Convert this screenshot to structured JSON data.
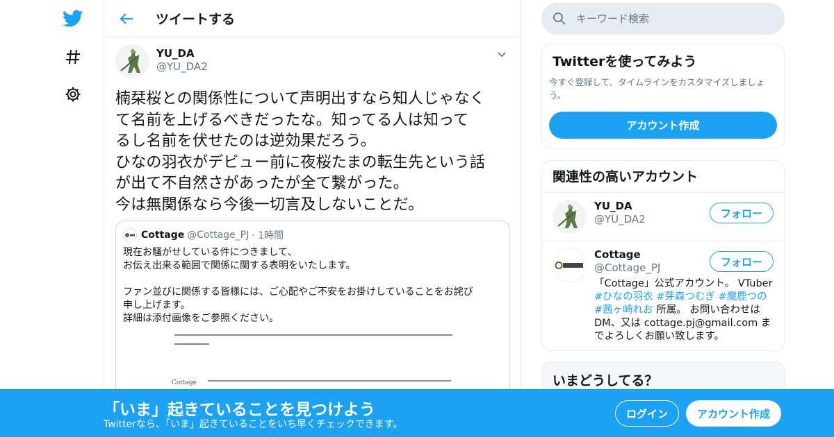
{
  "nav": {
    "icons": [
      "twitter-bird-icon",
      "hashtag-icon",
      "gear-icon"
    ]
  },
  "header": {
    "title": "ツイートする"
  },
  "tweet": {
    "author_name": "YU_DA",
    "author_handle": "@YU_DA2",
    "text": "楠栞桜との関係性について声明出すなら知人じゃなく\nて名前を上げるべきだったな。知ってる人は知って\nるし名前を伏せたのは逆効果だろう。\nひなの羽衣がデビュー前に夜桜たまの転生先という話\nが出て不自然さがあったが全て繋がった。\n今は無関係なら今後一切言及しないことだ。",
    "quote": {
      "name": "Cottage",
      "handle": "@Cottage_PJ",
      "time": "· 1時間",
      "text": "現在お騒がせしている件につきまして、\nお伝え出来る範囲で関係に関する表明をいたします。\n\nファン並びに関係する皆様には、ご心配やご不安をお掛けしていることをお詫び\n申し上げます。\n詳細は添付画像をご参照ください。",
      "image_line1": "",
      "image_line2": "Cottage"
    }
  },
  "search": {
    "placeholder": "キーワード検索"
  },
  "signup_card": {
    "title": "Twitterを使ってみよう",
    "desc": "今すぐ登録して、タイムラインをカスタマイズしましょう。",
    "button": "アカウント作成"
  },
  "related": {
    "title": "関連性の高いアカウント",
    "accounts": [
      {
        "name": "YU_DA",
        "handle": "@YU_DA2",
        "follow": "フォロー"
      },
      {
        "name": "Cottage",
        "handle": "@Cottage_PJ",
        "follow": "フォロー",
        "bio_pre": "「Cottage」公式アカウント。 VTuber ",
        "tags": [
          "#ひなの羽衣",
          "#芽森つむぎ",
          "#魔鹿つの",
          "#茜ヶ崎れお"
        ],
        "bio_post": " 所属。 お問い合わせは DM、又は cottage.pj@gmail.com までよろしくお願い致します。"
      }
    ]
  },
  "trends": {
    "title": "いまどうしてる？"
  },
  "banner": {
    "title": "「いま」起きていることを見つけよう",
    "subtitle": "Twitterなら、「いま」起きていることをいち早くチェックできます。",
    "login": "ログイン",
    "signup": "アカウント作成"
  },
  "colors": {
    "accent": "#1da1f2",
    "border": "#e6ecf0",
    "secondary_text": "#657786"
  }
}
